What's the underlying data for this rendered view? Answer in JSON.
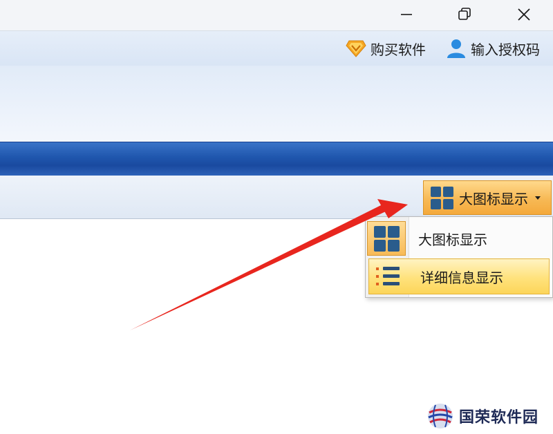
{
  "window": {
    "minimize_icon": "minimize-icon",
    "restore_icon": "restore-icon",
    "close_icon": "close-icon"
  },
  "account": {
    "buy_label": "购买软件",
    "buy_icon": "diamond-icon",
    "license_label": "输入授权码",
    "license_icon": "user-icon"
  },
  "toolbar": {
    "view_label": "大图标显示",
    "view_icon": "large-icons-icon"
  },
  "view_menu": {
    "items": [
      {
        "label": "大图标显示",
        "icon": "large-icons-icon"
      },
      {
        "label": "详细信息显示",
        "icon": "details-list-icon"
      }
    ]
  },
  "watermark": {
    "text": "国荣软件园"
  },
  "colors": {
    "accent_orange": "#f7b955",
    "band_blue": "#1f56ad",
    "annotation_red": "#e8261e"
  }
}
